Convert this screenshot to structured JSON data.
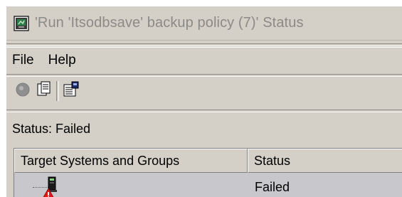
{
  "window": {
    "title": "'Run 'Itsodbsave' backup policy (7)' Status"
  },
  "menubar": {
    "items": [
      {
        "label": "File"
      },
      {
        "label": "Help"
      }
    ]
  },
  "toolbar": {
    "buttons": [
      {
        "icon": "stop-icon"
      },
      {
        "icon": "document-icon"
      },
      {
        "icon": "properties-icon"
      }
    ]
  },
  "status": {
    "text": "Status: Failed"
  },
  "table": {
    "columns": [
      "Target Systems and Groups",
      "Status"
    ],
    "rows": [
      {
        "target": "",
        "status": "Failed",
        "icon": "system-failed-icon"
      }
    ]
  }
}
